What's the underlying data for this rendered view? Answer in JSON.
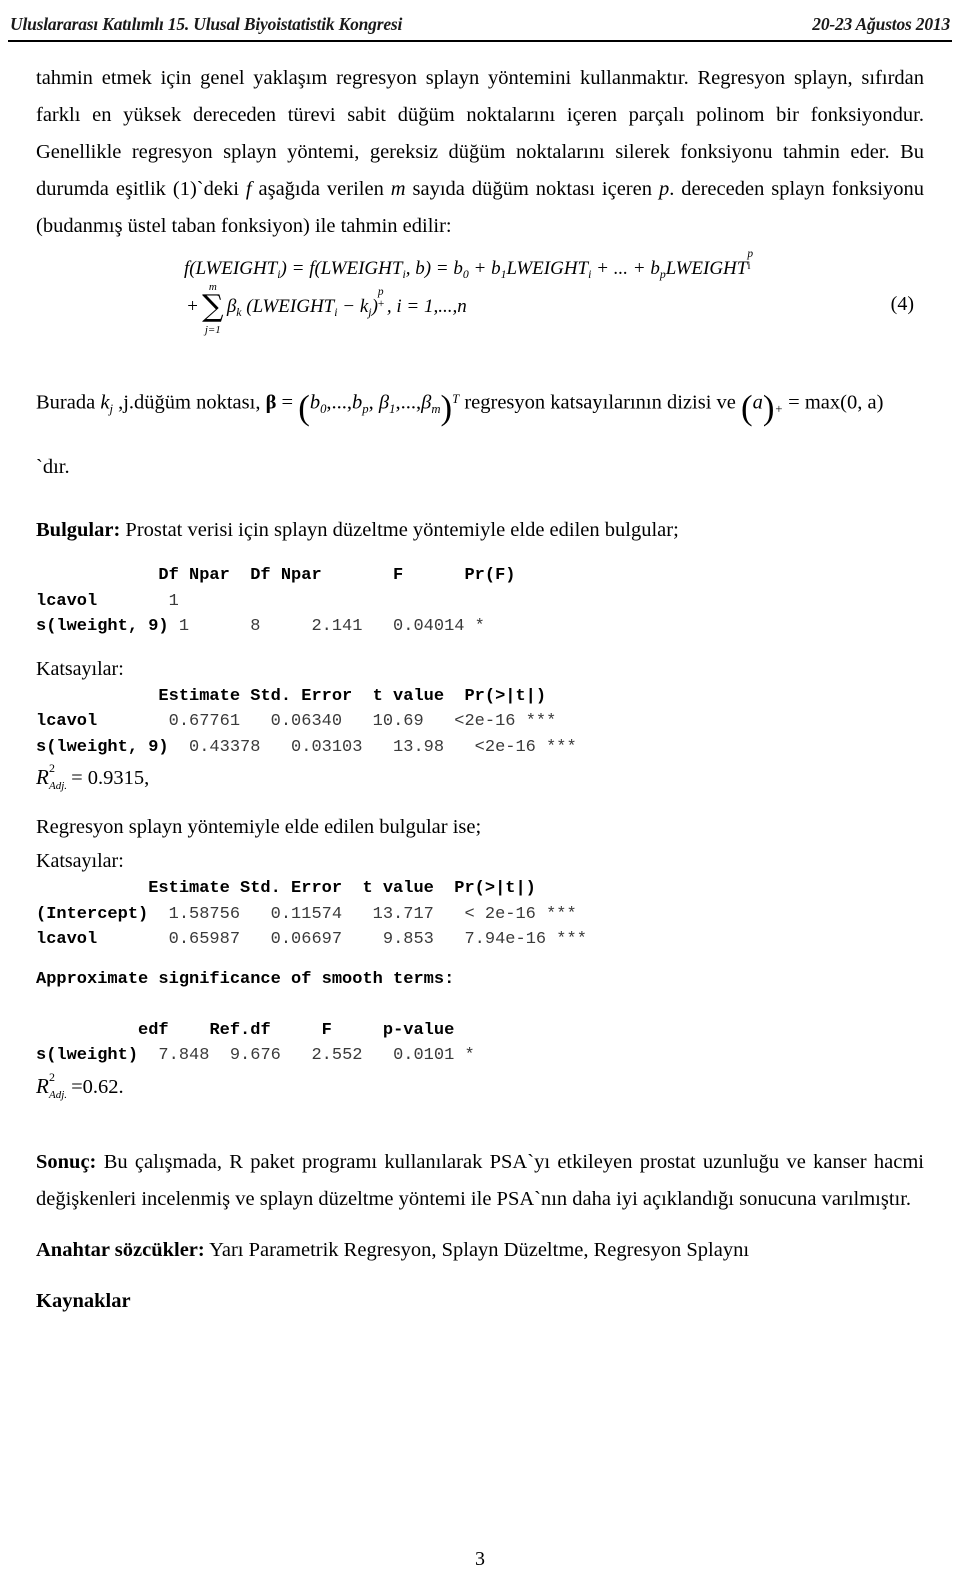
{
  "header": {
    "left": "Uluslararası Katılımlı 15. Ulusal Biyoistatistik Kongresi",
    "right": "20-23 Ağustos 2013"
  },
  "paragraphs": {
    "intro_1": "tahmin etmek için genel yaklaşım regresyon splayn yöntemini kullanmaktır. Regresyon splayn, sıfırdan farklı en yüksek dereceden türevi  sabit düğüm noktalarını  içeren  parçalı polinom  bir fonksiyondur. Genellikle regresyon splayn yöntemi, gereksiz düğüm noktalarını silerek fonksiyonu tahmin eder. Bu durumda eşitlik (1)`deki ",
    "intro_f": "f",
    "intro_2": " aşağıda verilen ",
    "intro_m": "m",
    "intro_3": " sayıda düğüm noktası içeren ",
    "intro_p": "p",
    "intro_4": ". dereceden splayn fonksiyonu (budanmış üstel taban fonksiyon) ile tahmin edilir:"
  },
  "equation": {
    "tag": "(4)",
    "line1": {
      "f1": "f",
      "open1": "(LWEIGHT",
      "sub_i1": "i",
      "close1": ")",
      "eq1": " = ",
      "f2": "f",
      "open2": "(LWEIGHT",
      "sub_i2": "i",
      "comma_b": ", b)",
      "eq2": " = ",
      "b0": "b",
      "sub_0": "0",
      "plus1": " + ",
      "b1": "b",
      "sub_1": "1",
      "lw1": "LWEIGHT",
      "sub_i3": "i",
      "dots": " + ... + ",
      "bp": "b",
      "sub_p": "p",
      "lw2": "LWEIGHT",
      "sub_i4": "i",
      "sup_p": "p"
    },
    "line2": {
      "plus": "+",
      "sigma_top": "m",
      "sigma_bottom": "j=1",
      "beta": "β",
      "beta_sub": "k",
      "open": "(LWEIGHT",
      "sub_i": "i",
      "minus_k": " − k",
      "k_sub": "j",
      "close": ")",
      "paren_sup": "p",
      "paren_sub": "+",
      "tail": ",  i = 1,...,n"
    }
  },
  "burada": {
    "prefix": "Burada ",
    "k": "k",
    "k_sub": "j",
    "mid": " ,j.düğüm noktası, ",
    "beta_bold": "β",
    "equals": " = ",
    "vector": "b",
    "vec_sub0": "0",
    "vec_dots1": ",...,",
    "vec_bp": "b",
    "vec_subp": "p",
    "vec_comma": ", ",
    "vec_beta1": "β",
    "vec_sub1": "1",
    "vec_dots2": ",...,",
    "vec_betam": "β",
    "vec_subm": "m",
    "transpose": "T",
    "tail": " regresyon katsayılarının dizisi ve ",
    "a": "a",
    "a_sub": "+",
    "max_eq": " = max",
    "max_args": "(0, a)",
    "next_line": "`dır."
  },
  "bulgular": {
    "label": "Bulgular:",
    "text": " Prostat verisi için splayn düzeltme yöntemiyle elde edilen bulgular;"
  },
  "r_output_1": {
    "header": "            Df Npar  Df Npar       F      Pr(F)",
    "rows": [
      "lcavol       1",
      "s(lweight, 9) 1      8     2.141   0.04014 *"
    ]
  },
  "katsayilar_label_1": "Katsayılar:",
  "r_output_2": {
    "header": "            Estimate Std. Error  t value  Pr(>|t|)",
    "rows": [
      "lcavol       0.67761   0.06340   10.69   <2e-16 ***",
      "s(lweight, 9)  0.43378   0.03103   13.98   <2e-16 ***"
    ]
  },
  "r2_adj_1": {
    "symbol_base": "R",
    "symbol_sup": "2",
    "symbol_sub": "Adj.",
    "value": "= 0.9315,"
  },
  "mid_text": "Regresyon splayn yöntemiyle elde edilen bulgular ise;",
  "katsayilar_label_2": "Katsayılar:",
  "r_output_3": {
    "header": "           Estimate Std. Error  t value  Pr(>|t|)",
    "rows": [
      "(Intercept)  1.58756   0.11574   13.717   < 2e-16 ***",
      "lcavol       0.65987   0.06697    9.853   7.94e-16 ***"
    ]
  },
  "approx_header": "Approximate significance of smooth terms:",
  "r_output_4": {
    "header": "          edf    Ref.df     F     p-value",
    "rows": [
      "s(lweight)  7.848  9.676   2.552   0.0101 *"
    ]
  },
  "r2_adj_2": {
    "symbol_base": "R",
    "symbol_sup": "2",
    "symbol_sub": "Adj.",
    "value": "=0.62."
  },
  "sonuc": {
    "label": "Sonuç:",
    "text": " Bu çalışmada, R paket programı kullanılarak  PSA`yı etkileyen prostat uzunluğu ve kanser hacmi değişkenleri incelenmiş  ve  splayn düzeltme yöntemi ile PSA`nın daha iyi açıklandığı sonucuna varılmıştır."
  },
  "anahtar": {
    "label": "Anahtar sözcükler:",
    "text": " Yarı Parametrik Regresyon, Splayn Düzeltme, Regresyon Splaynı"
  },
  "kaynaklar_label": "Kaynaklar",
  "page_number": "3"
}
